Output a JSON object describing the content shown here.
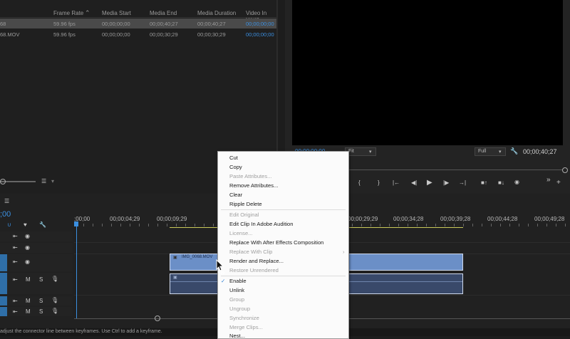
{
  "project": {
    "columns": [
      "Frame Rate",
      "Media Start",
      "Media End",
      "Media Duration",
      "Video In Point"
    ],
    "sort_arrow": "chevron-up-icon",
    "rows": [
      {
        "name": "68",
        "frame_rate": "59.96 fps",
        "media_start": "00;00;00;00",
        "media_end": "00;00;40;27",
        "media_duration": "00;00;40;27",
        "video_in": "00;00;00;00"
      },
      {
        "name": "68.MOV",
        "frame_rate": "59.96 fps",
        "media_start": "00;00;00;00",
        "media_end": "00;00;30;29",
        "media_duration": "00;00;30;29",
        "video_in": "00;00;00;00"
      }
    ]
  },
  "monitor": {
    "timecode_left": "00;00;00;00",
    "fit_label": "Fit",
    "full_label": "Full",
    "timecode_right": "00;00;40;27"
  },
  "timeline": {
    "current_time": ";00",
    "ruler": [
      ";00;00",
      "00;00;04;29",
      "00;00;09;29",
      "00;00;29;29",
      "00;00;34;28",
      "00;00;39;28",
      "00;00;44;28",
      "00;00;49;28"
    ],
    "clip_label": "IMG_0068.MOV",
    "status_text": "adjust the connector line between keyframes. Use Ctrl to add a keyframe."
  },
  "context_menu": {
    "items": [
      {
        "label": "Cut",
        "enabled": true
      },
      {
        "label": "Copy",
        "enabled": true
      },
      {
        "label": "Paste Attributes...",
        "enabled": false
      },
      {
        "label": "Remove Attributes...",
        "enabled": true
      },
      {
        "label": "Clear",
        "enabled": true
      },
      {
        "label": "Ripple Delete",
        "enabled": true
      },
      {
        "label": "Edit Original",
        "enabled": false
      },
      {
        "label": "Edit Clip In Adobe Audition",
        "enabled": true
      },
      {
        "label": "License...",
        "enabled": false
      },
      {
        "label": "Replace With After Effects Composition",
        "enabled": true
      },
      {
        "label": "Replace With Clip",
        "enabled": false
      },
      {
        "label": "Render and Replace...",
        "enabled": true
      },
      {
        "label": "Restore Unrendered",
        "enabled": false
      },
      {
        "label": "Enable",
        "enabled": true,
        "checked": true
      },
      {
        "label": "Unlink",
        "enabled": true
      },
      {
        "label": "Group",
        "enabled": false
      },
      {
        "label": "Ungroup",
        "enabled": false
      },
      {
        "label": "Synchronize",
        "enabled": false
      },
      {
        "label": "Merge Clips...",
        "enabled": false
      },
      {
        "label": "Nest...",
        "enabled": true
      }
    ]
  }
}
